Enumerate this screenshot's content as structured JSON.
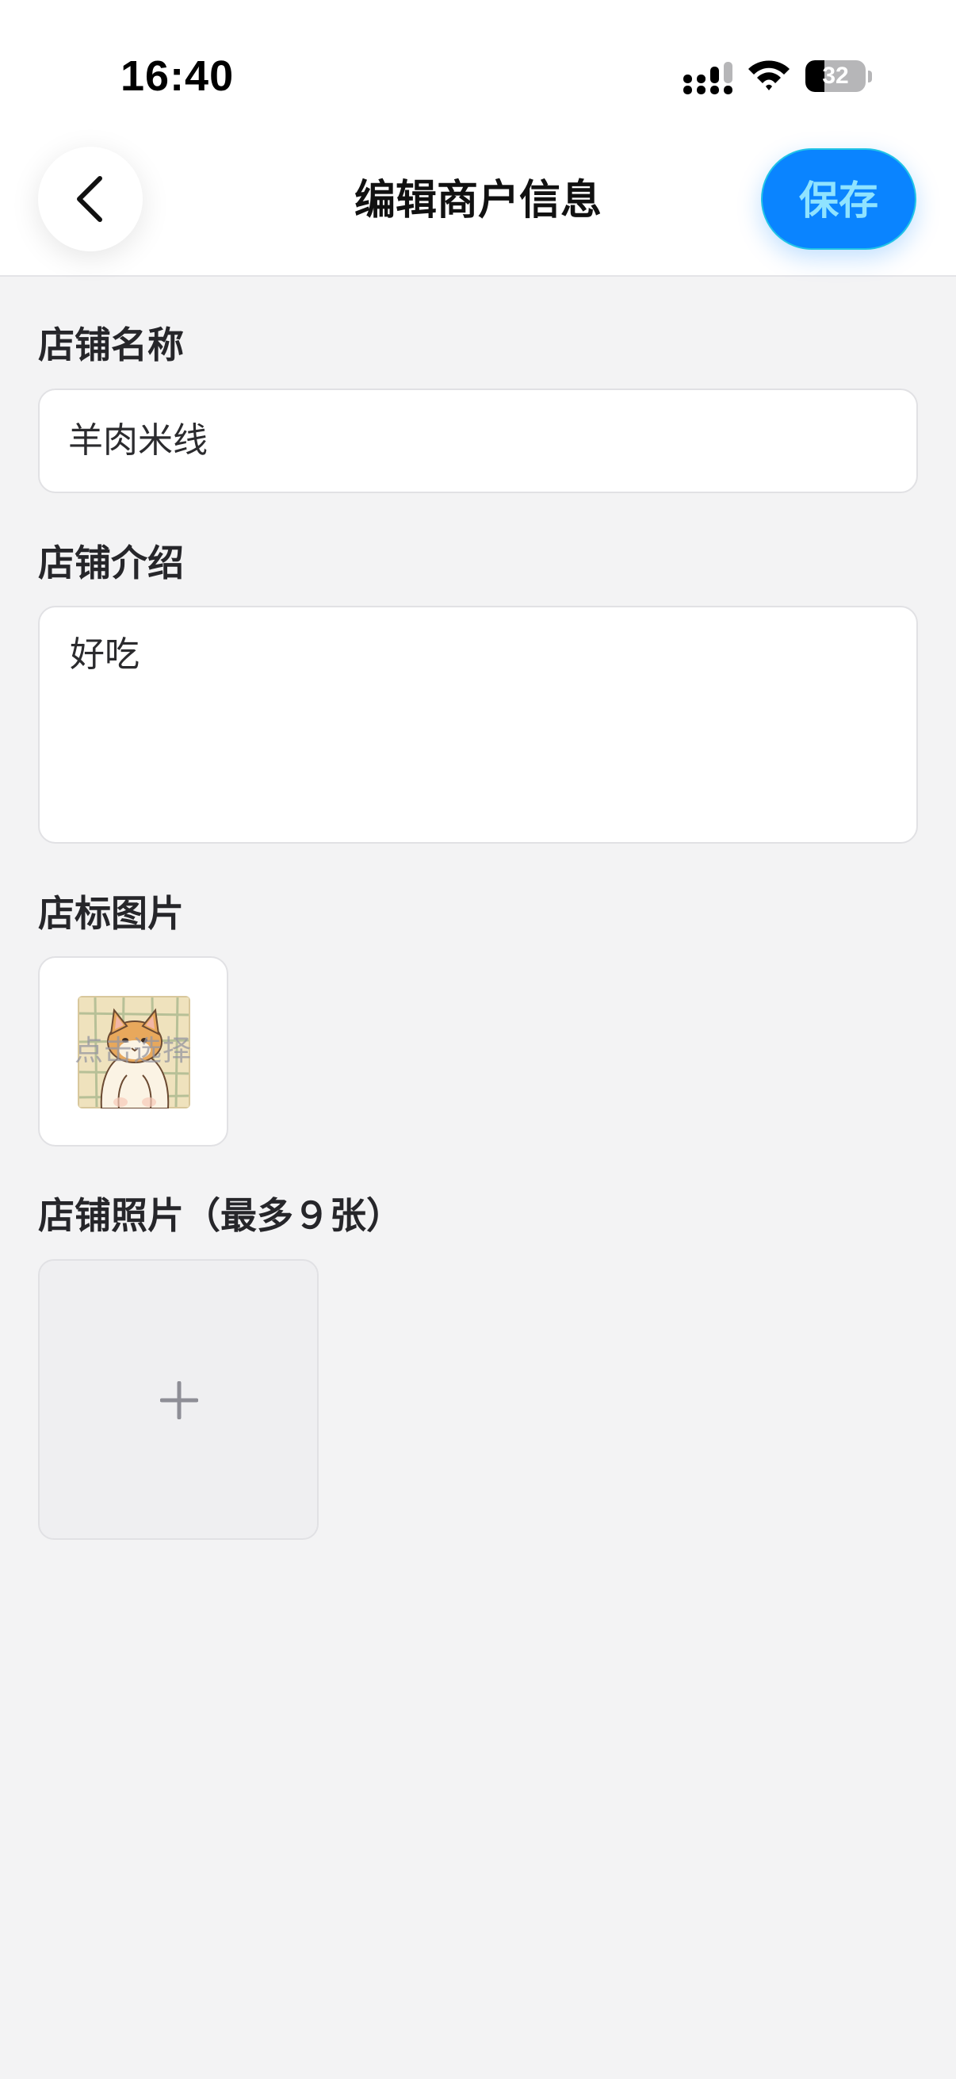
{
  "status_bar": {
    "time": "16:40",
    "battery": "32",
    "battery_level": 0.32,
    "signal_icon": "cellular-signal-icon",
    "wifi_icon": "wifi-icon"
  },
  "nav": {
    "back_icon": "chevron-left-icon",
    "title": "编辑商户信息",
    "save_label": "保存"
  },
  "form": {
    "name": {
      "label": "店铺名称",
      "value": "羊肉米线"
    },
    "intro": {
      "label": "店铺介绍",
      "value": "好吃"
    },
    "logo": {
      "label": "店标图片",
      "hint": "点击选择",
      "image": "cat-illustration"
    },
    "photos": {
      "label": "店铺照片（最多９张）",
      "add_icon": "plus-icon"
    }
  },
  "colors": {
    "accent": "#0a84ff",
    "save_text": "#8fe3ff",
    "background": "#f3f3f4"
  }
}
